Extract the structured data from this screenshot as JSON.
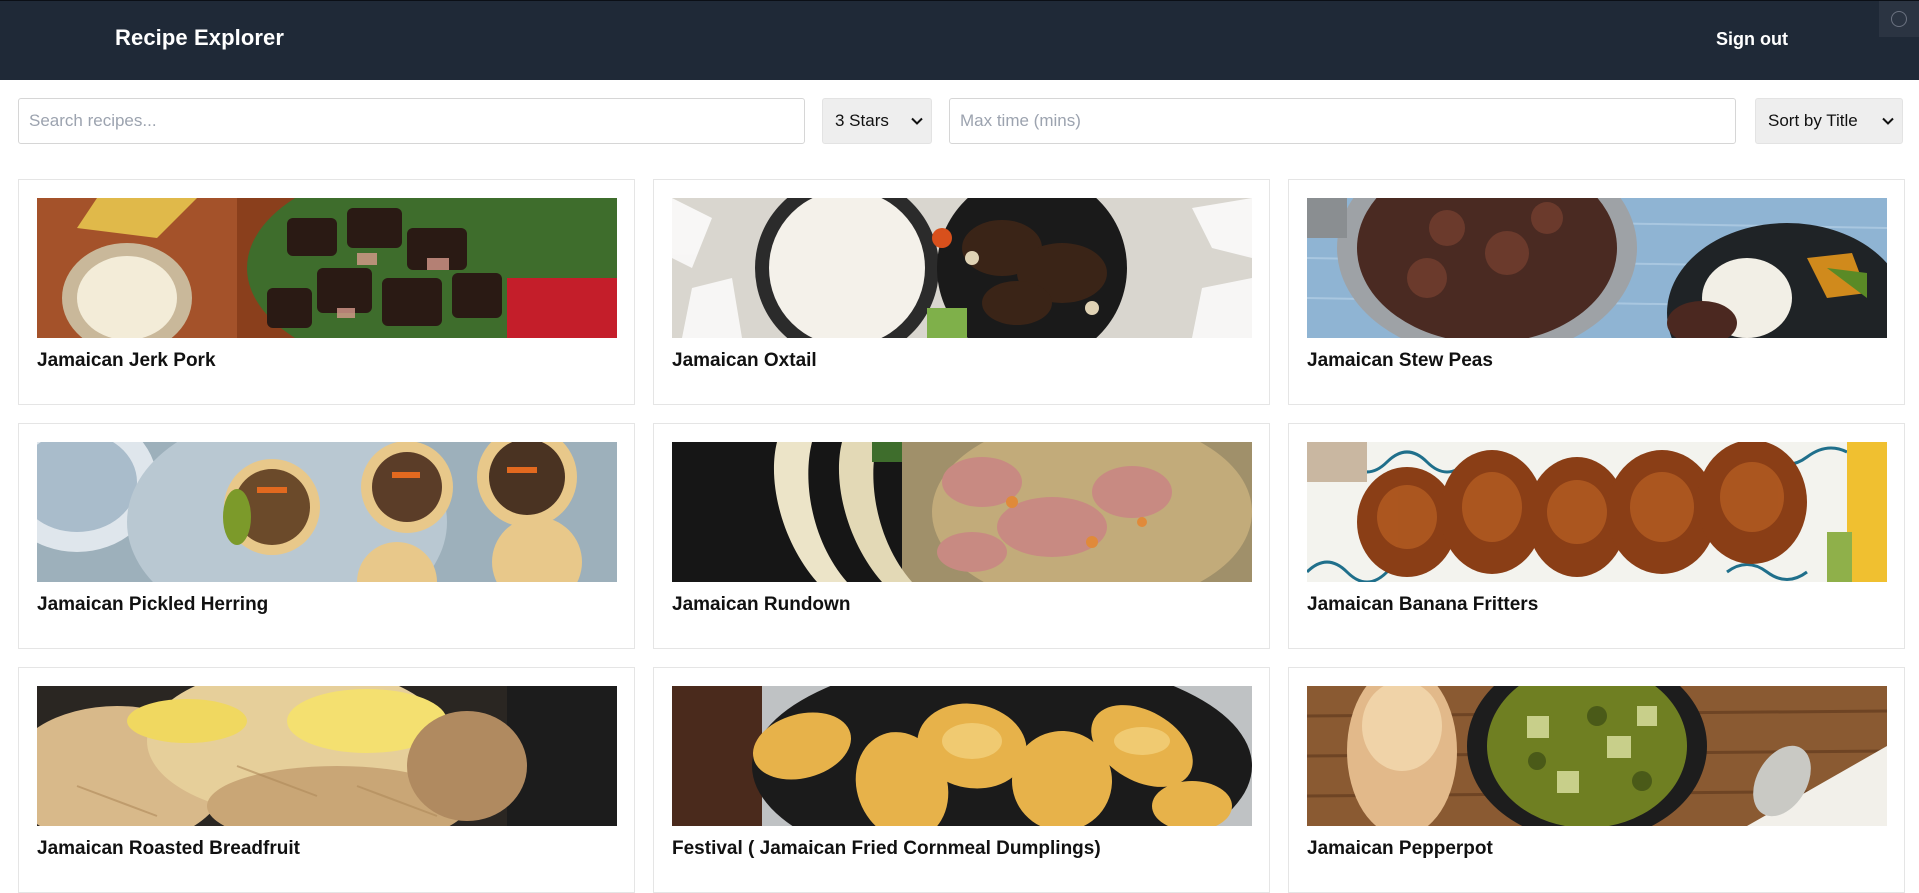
{
  "header": {
    "brand": "Recipe Explorer",
    "signout_label": "Sign out",
    "extension_icon": "extension-icon"
  },
  "filters": {
    "search_placeholder": "Search recipes...",
    "search_value": "",
    "rating_selected": "3 Stars",
    "maxtime_placeholder": "Max time (mins)",
    "maxtime_value": "",
    "sort_selected": "Sort by Title"
  },
  "recipes": [
    {
      "title": "Jamaican Jerk Pork",
      "image": "jerk-pork-photo"
    },
    {
      "title": "Jamaican Oxtail",
      "image": "oxtail-photo"
    },
    {
      "title": "Jamaican Stew Peas",
      "image": "stew-peas-photo"
    },
    {
      "title": "Jamaican Pickled Herring",
      "image": "pickled-herring-photo"
    },
    {
      "title": "Jamaican Rundown",
      "image": "rundown-photo"
    },
    {
      "title": "Jamaican Banana Fritters",
      "image": "banana-fritters-photo"
    },
    {
      "title": "Jamaican Roasted Breadfruit",
      "image": "roasted-breadfruit-photo"
    },
    {
      "title": "Festival ( Jamaican Fried Cornmeal Dumplings)",
      "image": "festival-dumplings-photo"
    },
    {
      "title": "Jamaican Pepperpot",
      "image": "pepperpot-photo"
    }
  ],
  "colors": {
    "navbar": "#1f2937",
    "card_border": "#e5e5e5",
    "select_bg": "#eeeeee"
  }
}
